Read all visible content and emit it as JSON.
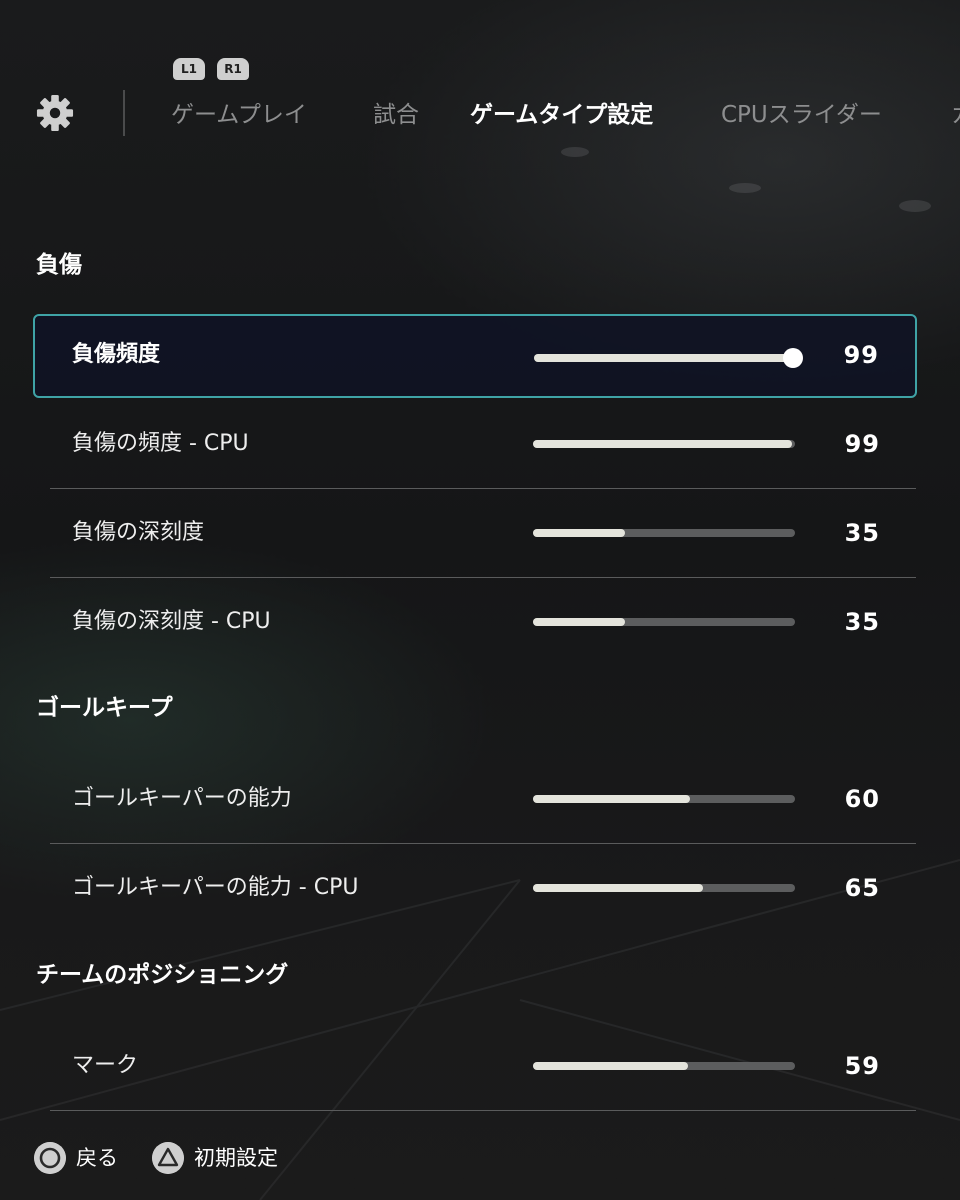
{
  "header": {
    "bumpers": {
      "left": "L1",
      "right": "R1"
    },
    "tabs": [
      {
        "label": "ゲームプレイ",
        "active": false
      },
      {
        "label": "試合",
        "active": false
      },
      {
        "label": "ゲームタイプ設定",
        "active": true
      },
      {
        "label": "CPUスライダー",
        "active": false
      },
      {
        "label": "カ",
        "active": false
      }
    ]
  },
  "sections": [
    {
      "title": "負傷",
      "rows": [
        {
          "label": "負傷頻度",
          "value": "99",
          "level": 0.99,
          "selected": true
        },
        {
          "label": "負傷の頻度 - CPU",
          "value": "99",
          "level": 0.99,
          "selected": false
        },
        {
          "label": "負傷の深刻度",
          "value": "35",
          "level": 0.35,
          "selected": false
        },
        {
          "label": "負傷の深刻度 - CPU",
          "value": "35",
          "level": 0.35,
          "selected": false
        }
      ]
    },
    {
      "title": "ゴールキープ",
      "rows": [
        {
          "label": "ゴールキーパーの能力",
          "value": "60",
          "level": 0.6,
          "selected": false
        },
        {
          "label": "ゴールキーパーの能力 - CPU",
          "value": "65",
          "level": 0.65,
          "selected": false
        }
      ]
    },
    {
      "title": "チームのポジショニング",
      "rows": [
        {
          "label": "マーク",
          "value": "59",
          "level": 0.59,
          "selected": false
        }
      ]
    }
  ],
  "footer": {
    "back_label": "戻る",
    "back_icon": "circle-button-icon",
    "reset_label": "初期設定",
    "reset_icon": "triangle-button-icon"
  },
  "colors": {
    "accent": "#3fa3a6",
    "slider_fill": "#e4e4dc",
    "slider_track": "#5c5d5e"
  }
}
